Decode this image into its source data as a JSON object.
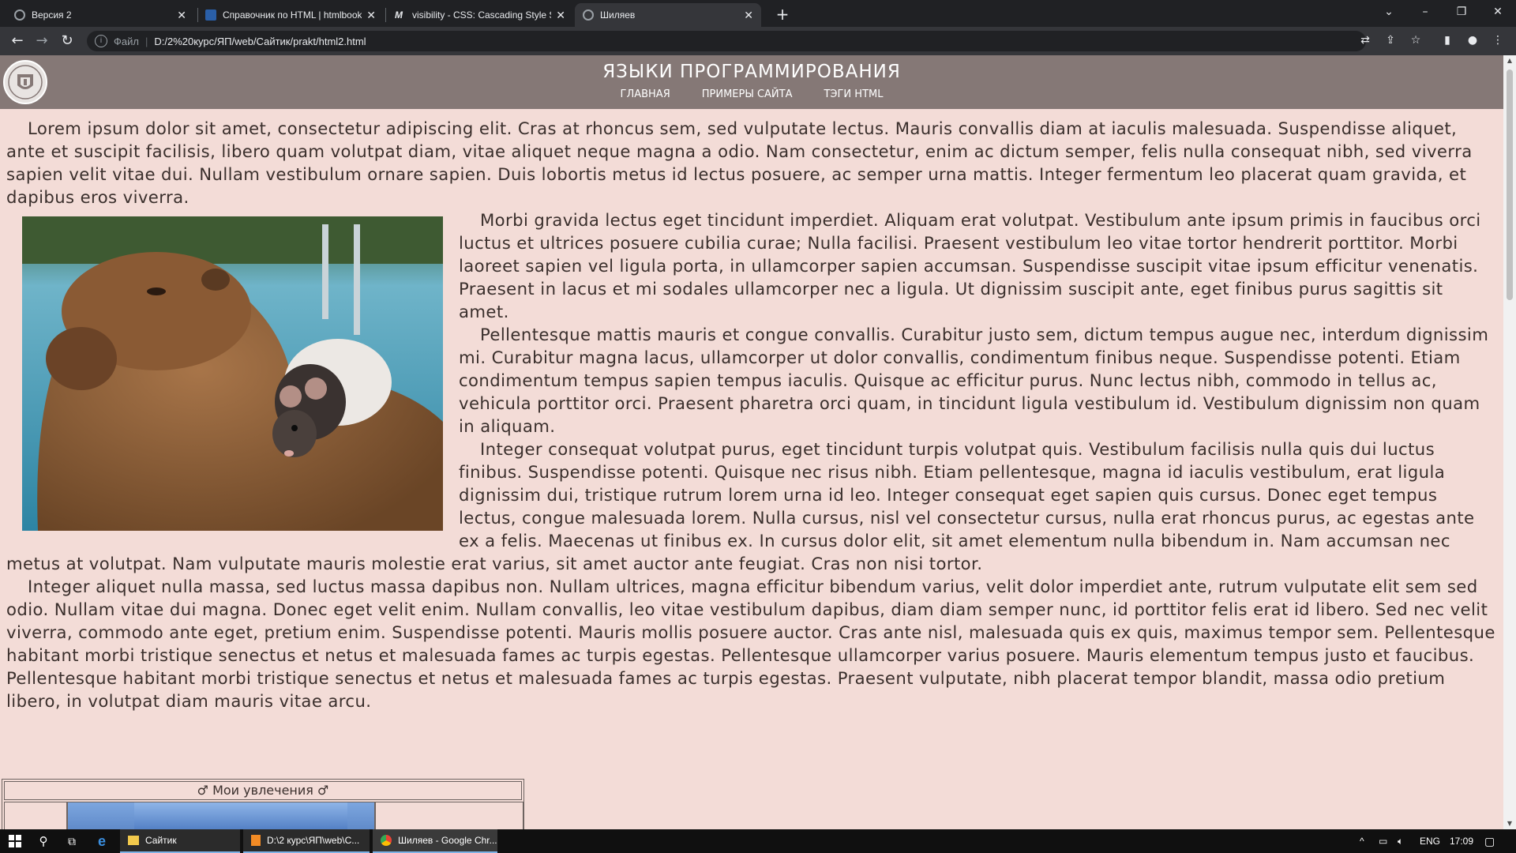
{
  "browser": {
    "tabs": [
      {
        "title": "Версия 2",
        "icon": "globe-icon"
      },
      {
        "title": "Справочник по HTML | htmlbook",
        "icon": "htmlbook-icon"
      },
      {
        "title": "visibility - CSS: Cascading Style Sheets",
        "icon": "mdn-icon"
      },
      {
        "title": "Шиляев",
        "icon": "globe-icon"
      }
    ],
    "new_tab": "+",
    "address": {
      "scheme_label": "Файл",
      "url": "D:/2%20курс/ЯП/web/Сайтик/prakt/html2.html"
    },
    "window_controls": {
      "minimize": "–",
      "restore": "❐",
      "close": "✕",
      "tab_search": "⌄"
    }
  },
  "site": {
    "title": "ЯЗЫКИ ПРОГРАММИРОВАНИЯ",
    "nav": [
      "ГЛАВНАЯ",
      "ПРИМЕРЫ САЙТА",
      "ТЭГИ HTML"
    ],
    "logo": "emblem-logo"
  },
  "content": {
    "paragraphs": [
      "Lorem ipsum dolor sit amet, consectetur adipiscing elit. Cras at rhoncus sem, sed vulputate lectus. Mauris convallis diam at iaculis malesuada. Suspendisse aliquet, ante et suscipit facilisis, libero quam volutpat diam, vitae aliquet neque magna a odio. Nam consectetur, enim ac dictum semper, felis nulla consequat nibh, sed viverra sapien velit vitae dui. Nullam vestibulum ornare sapien. Duis lobortis metus id lectus posuere, ac semper urna mattis. Integer fermentum leo placerat quam gravida, et dapibus eros viverra.",
      "Morbi gravida lectus eget tincidunt imperdiet. Aliquam erat volutpat. Vestibulum ante ipsum primis in faucibus orci luctus et ultrices posuere cubilia curae; Nulla facilisi. Praesent vestibulum leo vitae tortor hendrerit porttitor. Morbi laoreet sapien vel ligula porta, in ullamcorper sapien accumsan. Suspendisse suscipit vitae ipsum efficitur venenatis. Praesent in lacus et mi sodales ullamcorper nec a ligula. Ut dignissim suscipit ante, eget finibus purus sagittis sit amet.",
      "Pellentesque mattis mauris et congue convallis. Curabitur justo sem, dictum tempus augue nec, interdum dignissim mi. Curabitur magna lacus, ullamcorper ut dolor convallis, condimentum finibus neque. Suspendisse potenti. Etiam condimentum tempus sapien tempus iaculis. Quisque ac efficitur purus. Nunc lectus nibh, commodo in tellus ac, vehicula porttitor orci. Praesent pharetra orci quam, in tincidunt ligula vestibulum id. Vestibulum dignissim non quam in aliquam.",
      "Integer consequat volutpat purus, eget tincidunt turpis volutpat quis. Vestibulum facilisis nulla quis dui luctus finibus. Suspendisse potenti. Quisque nec risus nibh. Etiam pellentesque, magna id iaculis vestibulum, erat ligula dignissim dui, tristique rutrum lorem urna id leo. Integer consequat eget sapien quis cursus. Donec eget tempus lectus, congue malesuada lorem. Nulla cursus, nisl vel consectetur cursus, nulla erat rhoncus purus, ac egestas ante ex a felis. Maecenas ut finibus ex. In cursus dolor elit, sit amet elementum nulla bibendum in. Nam accumsan nec metus at volutpat. Nam vulputate mauris molestie erat varius, sit amet auctor ante feugiat. Cras non nisi tortor.",
      "Integer aliquet nulla massa, sed luctus massa dapibus non. Nullam ultrices, magna efficitur bibendum varius, velit dolor imperdiet ante, rutrum vulputate elit sem sed odio. Nullam vitae dui magna. Donec eget velit enim. Nullam convallis, leo vitae vestibulum dapibus, diam diam semper nunc, id porttitor felis erat id libero. Sed nec velit viverra, commodo ante eget, pretium enim. Suspendisse potenti. Mauris mollis posuere auctor. Cras ante nisl, malesuada quis ex quis, maximus tempor sem. Pellentesque habitant morbi tristique senectus et netus et malesuada fames ac turpis egestas. Pellentesque ullamcorper varius posuere. Mauris elementum tempus justo et faucibus. Pellentesque habitant morbi tristique senectus et netus et malesuada fames ac turpis egestas. Praesent vulputate, nibh placerat tempor blandit, massa odio pretium libero, in volutpat diam mauris vitae arcu."
    ],
    "image": "capybara-with-rat-photo",
    "hobby_caption": "♂ Мои увлечения ♂"
  },
  "taskbar": {
    "apps": [
      {
        "label": "Сайтик",
        "icon": "folder-icon"
      },
      {
        "label": "D:\\2 курс\\ЯП\\web\\С...",
        "icon": "sublime-icon"
      },
      {
        "label": "Шиляев - Google Chr...",
        "icon": "chrome-icon"
      }
    ],
    "lang": "ENG",
    "time": "17:09"
  },
  "colors": {
    "page_bg": "#f3dcd7",
    "header_bg": "#857876",
    "text": "#3a2f2c"
  }
}
